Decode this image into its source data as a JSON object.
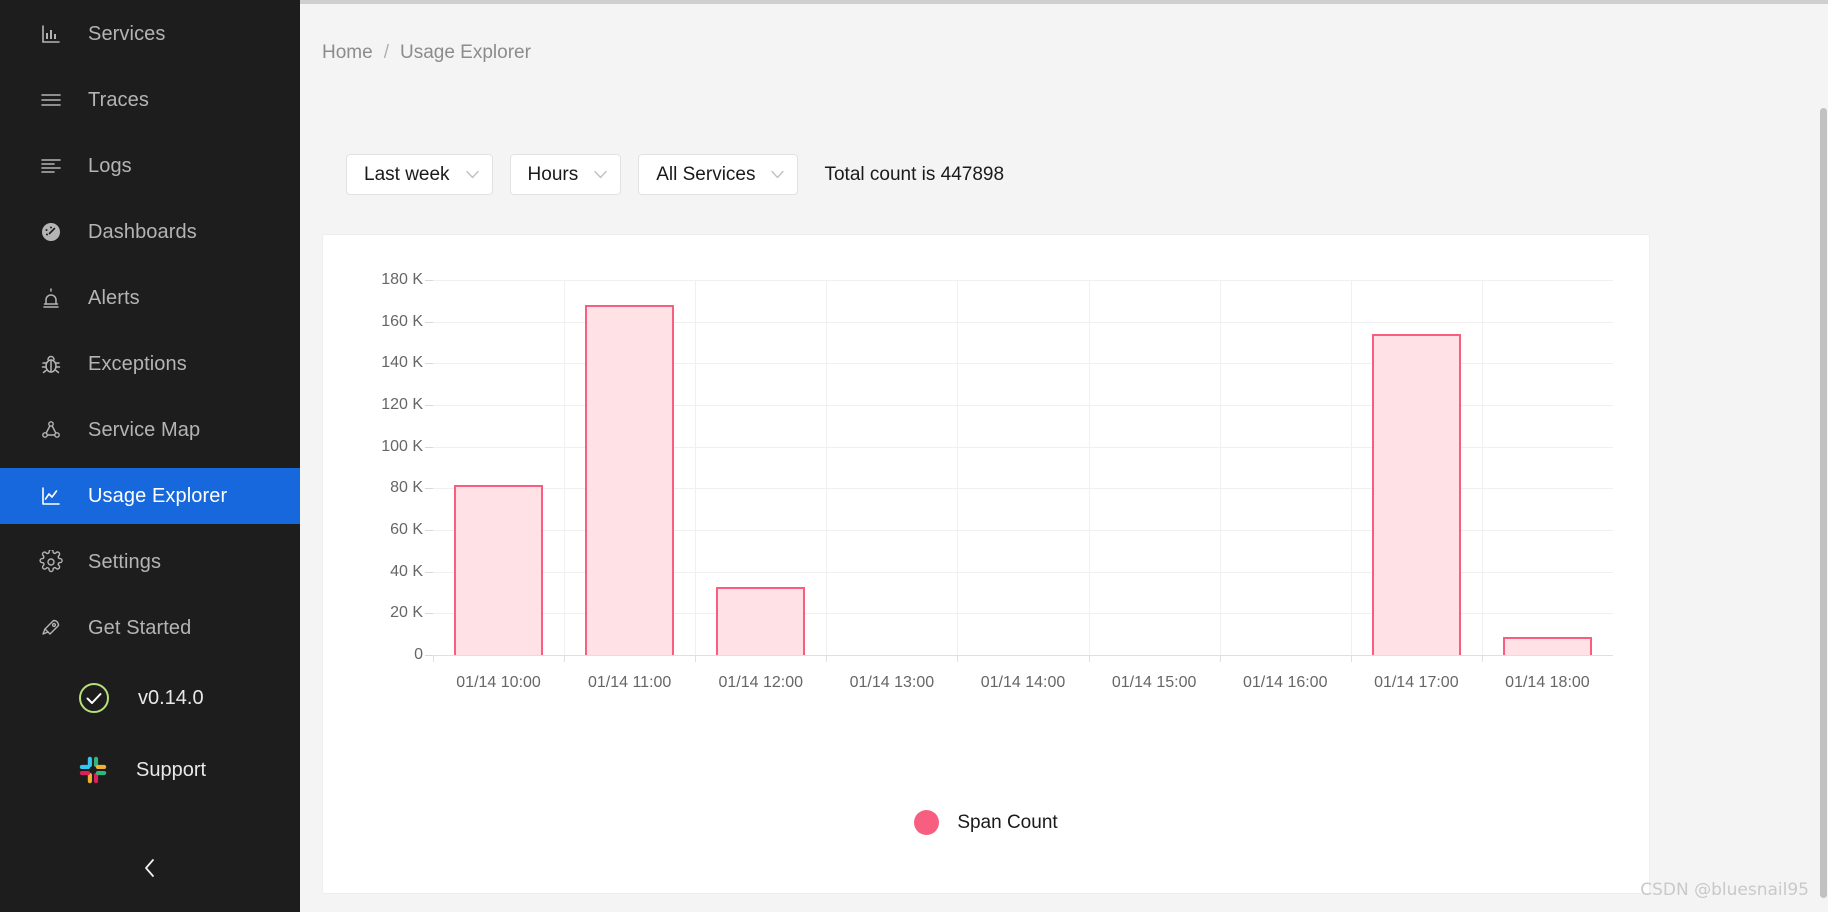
{
  "sidebar": {
    "items": [
      {
        "label": "Services",
        "icon": "bar-chart-icon",
        "active": false
      },
      {
        "label": "Traces",
        "icon": "menu-lines-icon",
        "active": false
      },
      {
        "label": "Logs",
        "icon": "align-left-icon",
        "active": false
      },
      {
        "label": "Dashboards",
        "icon": "gauge-icon",
        "active": false
      },
      {
        "label": "Alerts",
        "icon": "siren-icon",
        "active": false
      },
      {
        "label": "Exceptions",
        "icon": "bug-icon",
        "active": false
      },
      {
        "label": "Service Map",
        "icon": "node-graph-icon",
        "active": false
      },
      {
        "label": "Usage Explorer",
        "icon": "line-chart-icon",
        "active": true
      },
      {
        "label": "Settings",
        "icon": "gear-icon",
        "active": false
      },
      {
        "label": "Get Started",
        "icon": "rocket-icon",
        "active": false
      }
    ],
    "version": {
      "label": "v0.14.0",
      "icon": "check-circle-icon"
    },
    "support": {
      "label": "Support",
      "icon": "slack-icon"
    },
    "collapse": {
      "icon": "chevron-left-icon"
    },
    "colors": {
      "background": "#1d1d1d",
      "active": "#1668dc",
      "text": "#b4b4b4",
      "version_ring": "#b7e07a"
    }
  },
  "breadcrumb": {
    "home": "Home",
    "separator": "/",
    "current": "Usage Explorer"
  },
  "filters": {
    "time_range": {
      "value": "Last week",
      "caret": "chevron-down-icon"
    },
    "interval": {
      "value": "Hours",
      "caret": "chevron-down-icon"
    },
    "service": {
      "value": "All Services",
      "caret": "chevron-down-icon"
    },
    "total_count": "Total count is 447898"
  },
  "chart_data": {
    "type": "bar",
    "title": "",
    "xlabel": "",
    "ylabel": "",
    "grid": true,
    "legend_position": "bottom",
    "ylim": [
      0,
      180000
    ],
    "ytick_labels": [
      "0",
      "20 K",
      "40 K",
      "60 K",
      "80 K",
      "100 K",
      "120 K",
      "140 K",
      "160 K",
      "180 K"
    ],
    "ytick_values": [
      0,
      20000,
      40000,
      60000,
      80000,
      100000,
      120000,
      140000,
      160000,
      180000
    ],
    "categories": [
      "01/14 10:00",
      "01/14 11:00",
      "01/14 12:00",
      "01/14 13:00",
      "01/14 14:00",
      "01/14 15:00",
      "01/14 16:00",
      "01/14 17:00",
      "01/14 18:00"
    ],
    "series": [
      {
        "name": "Span Count",
        "color": "#f75e7f",
        "fill": "#ffe1e6",
        "values": [
          81800,
          168100,
          32500,
          0,
          0,
          0,
          0,
          153900,
          8500
        ]
      }
    ],
    "legend": [
      "Span Count"
    ]
  },
  "watermark": "CSDN @bluesnail95"
}
